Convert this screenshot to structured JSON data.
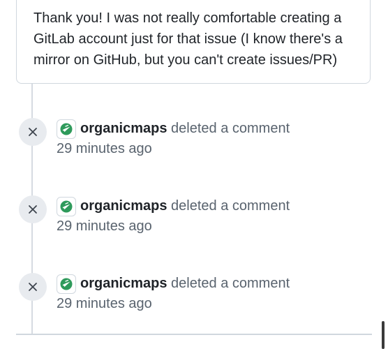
{
  "comment": {
    "text": "Thank you! I was not really comfortable creating a GitLab account just for that issue (I know there's a mirror on GitHub, but you can't create issues/PR)"
  },
  "events": [
    {
      "username": "organicmaps",
      "action": "deleted a comment",
      "time": "29 minutes ago",
      "event_icon": "x-icon",
      "avatar_icon": "organicmaps-logo"
    },
    {
      "username": "organicmaps",
      "action": "deleted a comment",
      "time": "29 minutes ago",
      "event_icon": "x-icon",
      "avatar_icon": "organicmaps-logo"
    },
    {
      "username": "organicmaps",
      "action": "deleted a comment",
      "time": "29 minutes ago",
      "event_icon": "x-icon",
      "avatar_icon": "organicmaps-logo"
    }
  ],
  "colors": {
    "brand_green": "#2e9a5b",
    "muted_text": "#59636e",
    "border": "#d0d7de",
    "icon_bg": "#e8ebef"
  }
}
